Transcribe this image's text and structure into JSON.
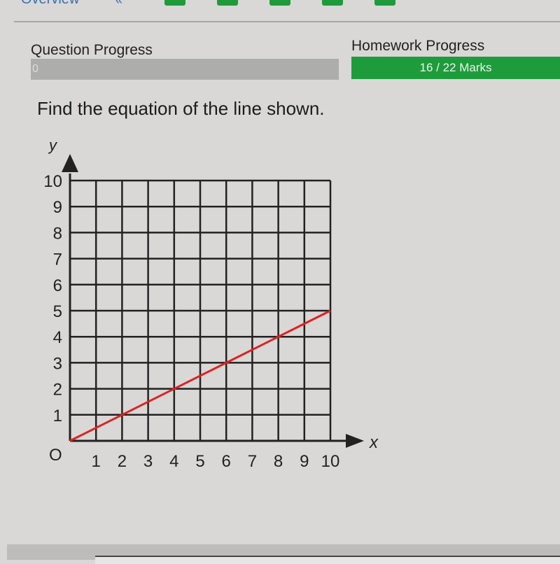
{
  "nav": {
    "overview": "Overview",
    "prev": "«",
    "question_buttons_color": "#1f9a3a"
  },
  "question_progress": {
    "label": "Question Progress",
    "value_text": "0",
    "percent": 0
  },
  "homework_progress": {
    "label": "Homework Progress",
    "text": "16 / 22 Marks",
    "marks": 16,
    "total": 22,
    "color": "#1e9c3c"
  },
  "question": {
    "text": "Find the equation of the line shown."
  },
  "chart_data": {
    "type": "line",
    "xlabel": "x",
    "ylabel": "y",
    "origin_label": "O",
    "xlim": [
      0,
      10
    ],
    "ylim": [
      0,
      10
    ],
    "x_ticks": [
      "1",
      "2",
      "3",
      "4",
      "5",
      "6",
      "7",
      "8",
      "9",
      "10"
    ],
    "y_ticks": [
      "1",
      "2",
      "3",
      "4",
      "5",
      "6",
      "7",
      "8",
      "9",
      "10"
    ],
    "grid": true,
    "series": [
      {
        "x": [
          0,
          10
        ],
        "y": [
          0,
          5
        ],
        "color": "#e02020"
      }
    ]
  }
}
